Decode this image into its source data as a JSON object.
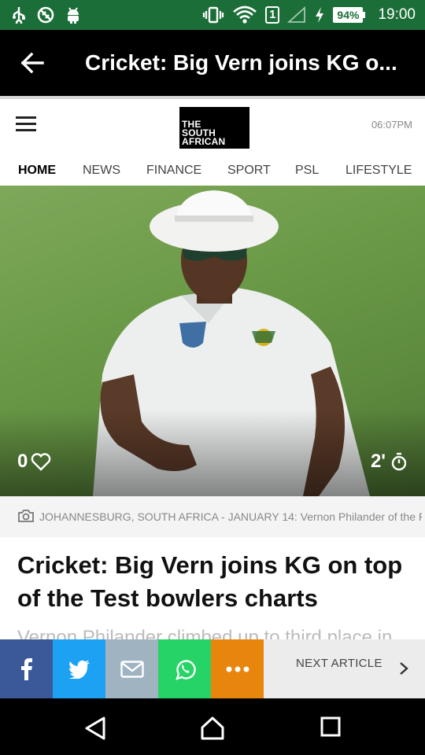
{
  "status_bar": {
    "icons": [
      "usb-icon",
      "no-sim-icon",
      "android-icon",
      "vibrate-icon",
      "wifi-icon",
      "sim-1-icon",
      "signal-icon",
      "charging-icon"
    ],
    "sim_slot": "1",
    "battery": "94%",
    "time": "19:00"
  },
  "app_bar": {
    "title": "Cricket: Big Vern joins KG o..."
  },
  "site": {
    "logo_lines": [
      "THE",
      "SOUTH",
      "AFRICAN"
    ],
    "time": "06:07PM",
    "nav_tabs": [
      {
        "label": "HOME",
        "active": true
      },
      {
        "label": "NEWS",
        "active": false
      },
      {
        "label": "FINANCE",
        "active": false
      },
      {
        "label": "SPORT",
        "active": false
      },
      {
        "label": "PSL",
        "active": false
      },
      {
        "label": "LIFESTYLE",
        "active": false
      }
    ]
  },
  "hero": {
    "likes": "0",
    "read_time": "2'"
  },
  "caption": {
    "text": "JOHANNESBURG, SOUTH AFRICA - JANUARY 14: Vernon Philander of the P"
  },
  "article": {
    "headline": "Cricket: Big Vern joins KG on top of the Test bowlers charts",
    "teaser": "Vernon Philander climbed up to third place in the"
  },
  "share_bar": {
    "buttons": [
      {
        "name": "facebook",
        "color": "#3b5998"
      },
      {
        "name": "twitter",
        "color": "#1da1f2"
      },
      {
        "name": "email",
        "color": "#9fb3c1"
      },
      {
        "name": "whatsapp",
        "color": "#25d366"
      },
      {
        "name": "more",
        "color": "#e8850c"
      }
    ],
    "next_label": "NEXT ARTICLE"
  },
  "colors": {
    "status_bar": "#1c6e38",
    "app_bar": "#000000",
    "next_article_bg": "#ececec"
  }
}
